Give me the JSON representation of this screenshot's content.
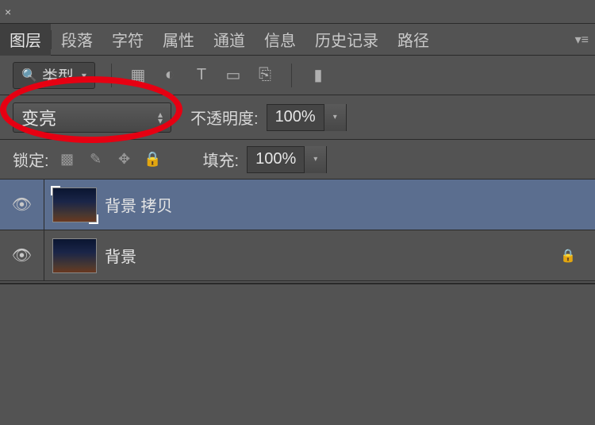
{
  "titlebar": {
    "close_glyph": "×"
  },
  "tabs": {
    "layers": "图层",
    "paragraph": "段落",
    "character": "字符",
    "properties": "属性",
    "channels": "通道",
    "info": "信息",
    "history": "历史记录",
    "paths": "路径"
  },
  "filter": {
    "type_label": "类型",
    "icons": {
      "image": "▦",
      "adjust": "◐",
      "type": "T",
      "shape": "▭",
      "smart": "⎘",
      "toggle": "▮"
    }
  },
  "blend": {
    "mode": "变亮",
    "opacity_label": "不透明度:",
    "opacity_value": "100%"
  },
  "lock": {
    "label": "锁定:",
    "fill_label": "填充:",
    "fill_value": "100%"
  },
  "layers": [
    {
      "name": "背景 拷贝",
      "selected": true,
      "locked": false
    },
    {
      "name": "背景",
      "selected": false,
      "locked": true
    }
  ],
  "glyphs": {
    "collapse": "◀◀",
    "menu": "▾≡",
    "search": "🔍",
    "chevron_down": "▾",
    "updown": "▴▾",
    "eye": "👁",
    "checker": "▩",
    "brush": "✎",
    "move": "✥",
    "lock": "🔒"
  }
}
